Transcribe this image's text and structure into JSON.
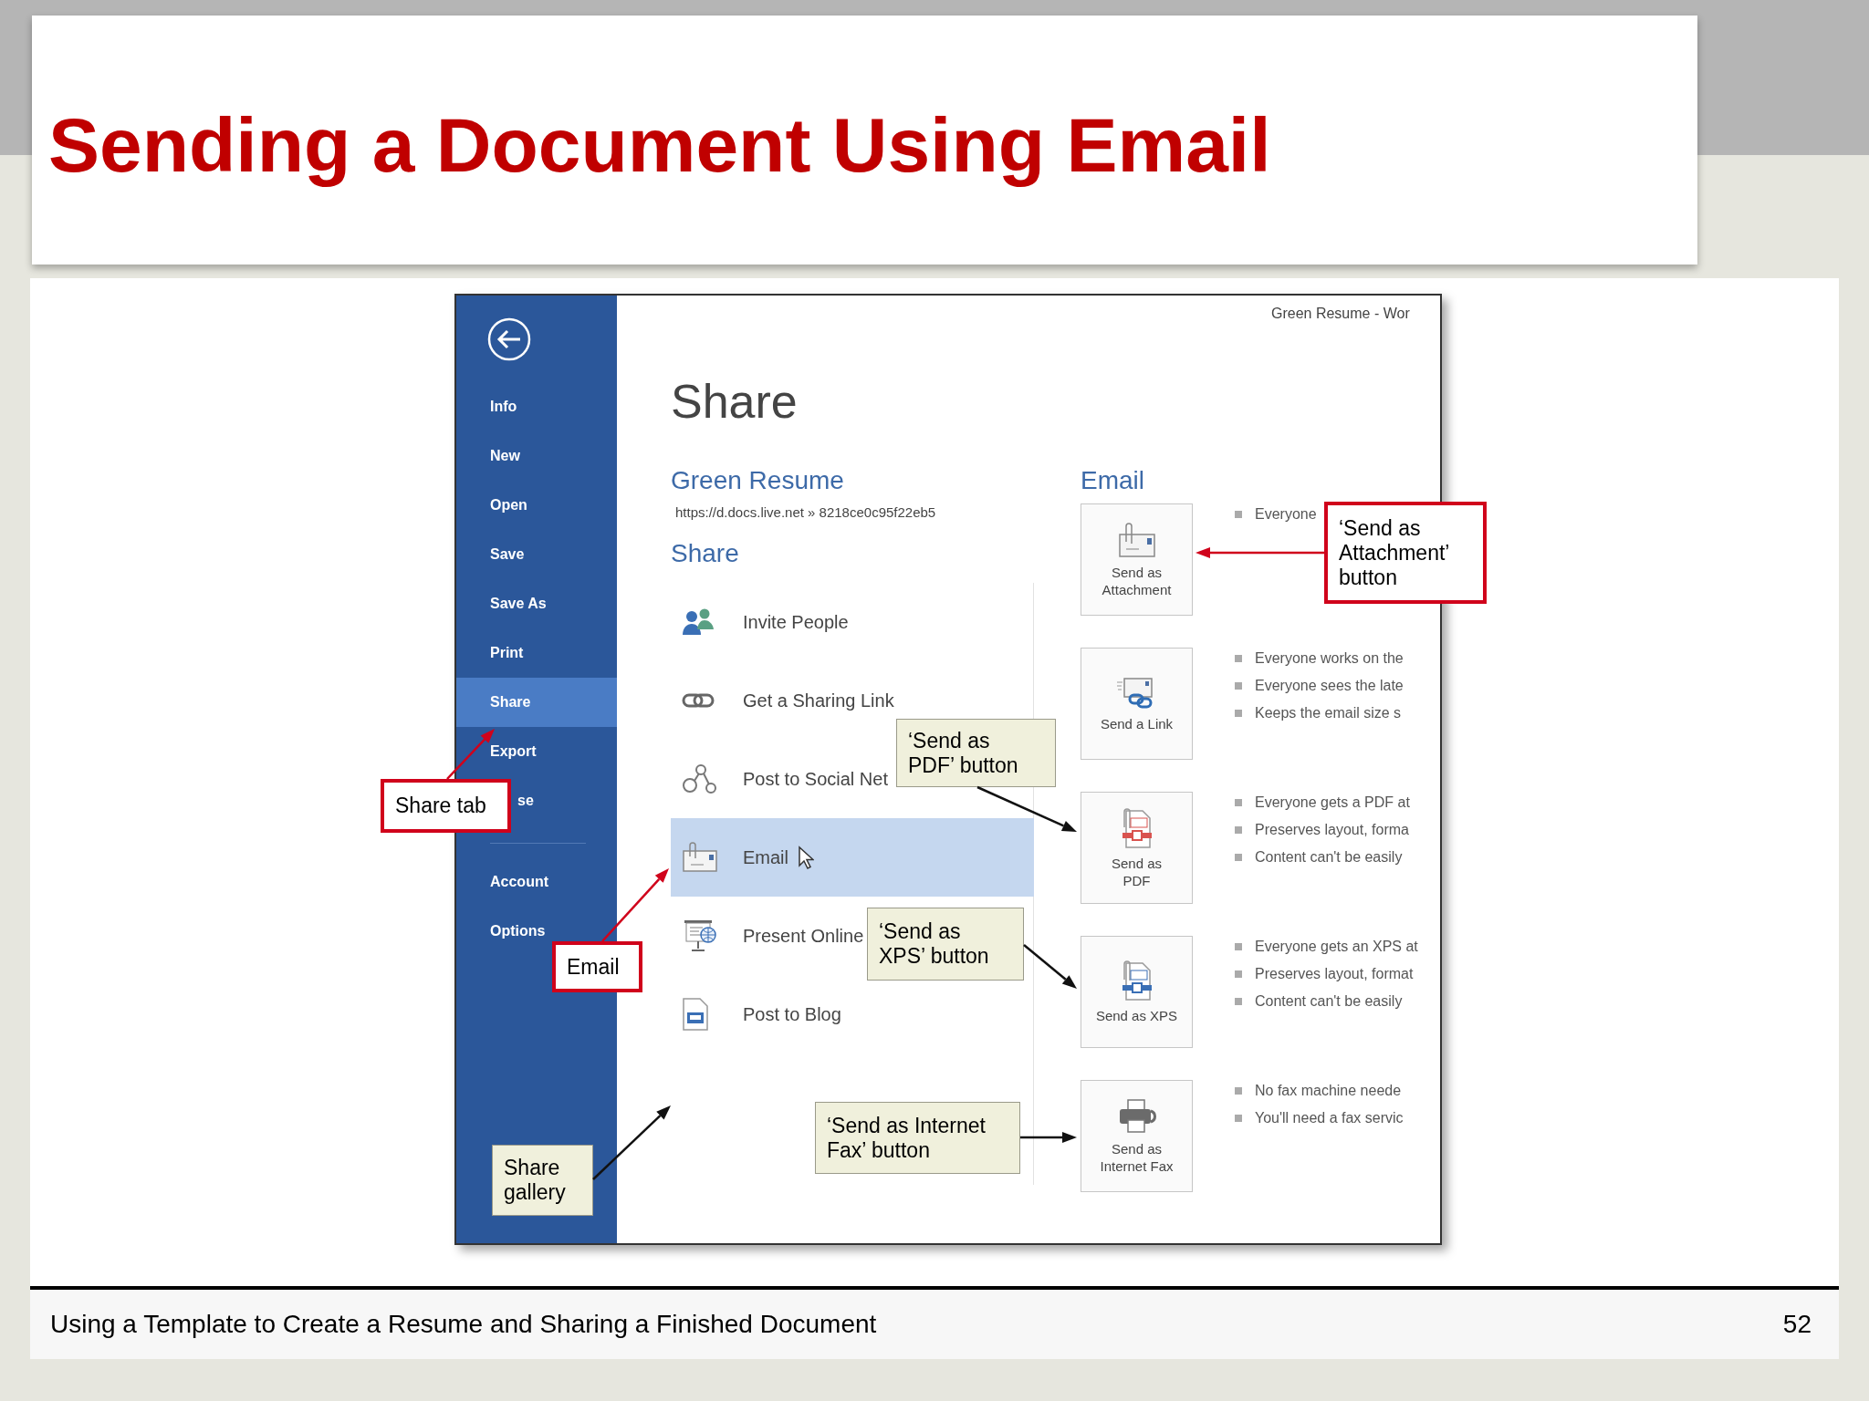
{
  "slide": {
    "title": "Sending a Document Using Email",
    "footer": "Using a Template to Create a Resume and Sharing a Finished Document",
    "page_number": "52"
  },
  "window": {
    "title": "Green Resume - Wor"
  },
  "sidebar": {
    "items": [
      {
        "label": "Info",
        "selected": false
      },
      {
        "label": "New",
        "selected": false
      },
      {
        "label": "Open",
        "selected": false
      },
      {
        "label": "Save",
        "selected": false
      },
      {
        "label": "Save As",
        "selected": false
      },
      {
        "label": "Print",
        "selected": false
      },
      {
        "label": "Share",
        "selected": true
      },
      {
        "label": "Export",
        "selected": false
      },
      {
        "label": "se",
        "selected": false,
        "partly_hidden": true
      }
    ],
    "bottom_items": [
      {
        "label": "Account",
        "selected": false
      },
      {
        "label": "Options",
        "selected": false
      }
    ]
  },
  "share": {
    "heading": "Share",
    "document": "Green Resume",
    "url": "https://d.docs.live.net » 8218ce0c95f22eb5",
    "section": "Share",
    "options": [
      {
        "kind": "people",
        "label": "Invite People",
        "selected": false
      },
      {
        "kind": "link",
        "label": "Get a Sharing Link",
        "selected": false
      },
      {
        "kind": "social",
        "label": "Post to Social Net",
        "selected": false
      },
      {
        "kind": "email",
        "label": "Email",
        "selected": true
      },
      {
        "kind": "present",
        "label": "Present Online",
        "selected": false
      },
      {
        "kind": "blog",
        "label": "Post to Blog",
        "selected": false
      }
    ]
  },
  "email": {
    "heading": "Email",
    "buttons": [
      {
        "kind": "attachment",
        "lines": [
          "Send as",
          "Attachment"
        ],
        "notes": [
          "Everyone"
        ]
      },
      {
        "kind": "link",
        "lines": [
          "Send a Link"
        ],
        "notes": [
          "Everyone works on the",
          "Everyone sees the late",
          "Keeps the email size s"
        ]
      },
      {
        "kind": "pdf",
        "lines": [
          "Send as",
          "PDF"
        ],
        "notes": [
          "Everyone gets a PDF at",
          "Preserves layout, forma",
          "Content can't be easily"
        ]
      },
      {
        "kind": "xps",
        "lines": [
          "Send as XPS"
        ],
        "notes": [
          "Everyone gets an XPS at",
          "Preserves layout, format",
          "Content can't be easily"
        ]
      },
      {
        "kind": "fax",
        "lines": [
          "Send as",
          "Internet Fax"
        ],
        "notes": [
          "No fax machine neede",
          "You'll need a fax servic"
        ]
      }
    ]
  },
  "callouts": [
    {
      "kind": "emphasis",
      "lines": [
        "Share tab"
      ]
    },
    {
      "kind": "emphasis",
      "lines": [
        "Email"
      ]
    },
    {
      "kind": "emphasis",
      "lines": [
        "‘Send as",
        "Attachment’",
        "button"
      ]
    },
    {
      "kind": "standard",
      "lines": [
        "‘Send as",
        "PDF’ button"
      ]
    },
    {
      "kind": "standard",
      "lines": [
        "‘Send as",
        "XPS’ button"
      ]
    },
    {
      "kind": "standard",
      "lines": [
        "‘Send as Internet",
        "Fax’ button"
      ]
    },
    {
      "kind": "standard",
      "lines": [
        "Share",
        "gallery"
      ]
    }
  ]
}
